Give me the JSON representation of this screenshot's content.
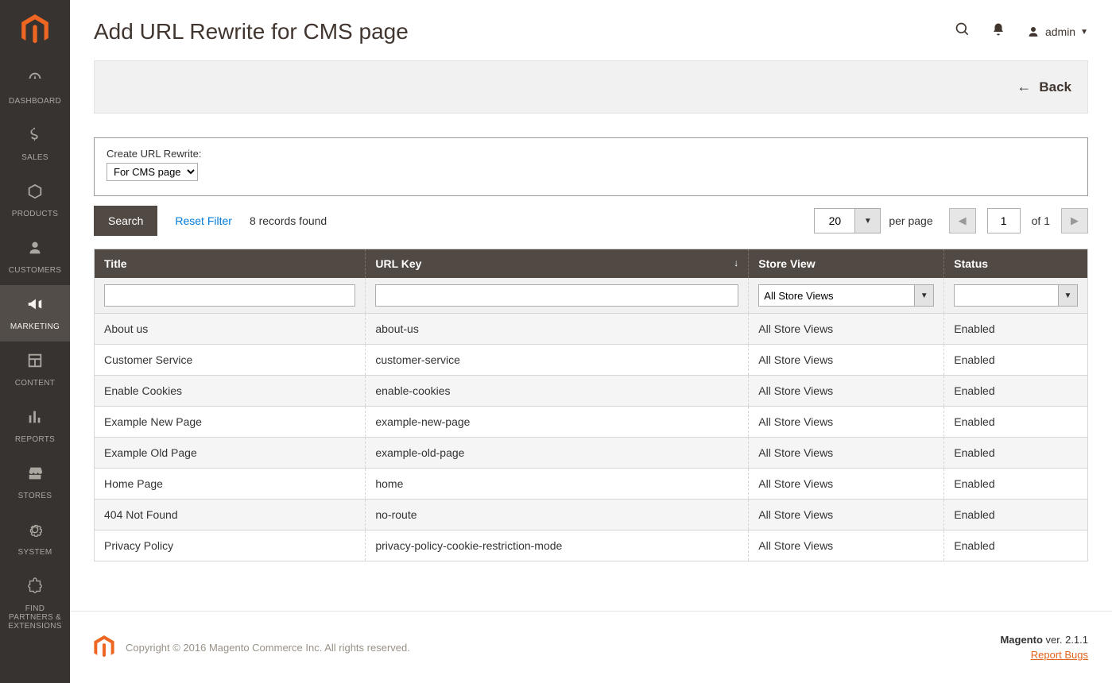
{
  "sidebar": {
    "items": [
      {
        "label": "DASHBOARD"
      },
      {
        "label": "SALES"
      },
      {
        "label": "PRODUCTS"
      },
      {
        "label": "CUSTOMERS"
      },
      {
        "label": "MARKETING"
      },
      {
        "label": "CONTENT"
      },
      {
        "label": "REPORTS"
      },
      {
        "label": "STORES"
      },
      {
        "label": "SYSTEM"
      },
      {
        "label": "FIND PARTNERS & EXTENSIONS"
      }
    ]
  },
  "header": {
    "title": "Add URL Rewrite for CMS page",
    "admin": "admin"
  },
  "toolbar": {
    "back": "Back"
  },
  "rewrite": {
    "label": "Create URL Rewrite:",
    "selected": "For CMS page"
  },
  "grid": {
    "search_label": "Search",
    "reset_label": "Reset Filter",
    "records_found": "8 records found",
    "per_page_value": "20",
    "per_page_label": "per page",
    "page_value": "1",
    "of_label": "of 1"
  },
  "columns": {
    "title": "Title",
    "url_key": "URL Key",
    "store_view": "Store View",
    "status": "Status"
  },
  "filters": {
    "store_view_selected": "All Store Views"
  },
  "rows": [
    {
      "title": "About us",
      "url_key": "about-us",
      "store": "All Store Views",
      "status": "Enabled"
    },
    {
      "title": "Customer Service",
      "url_key": "customer-service",
      "store": "All Store Views",
      "status": "Enabled"
    },
    {
      "title": "Enable Cookies",
      "url_key": "enable-cookies",
      "store": "All Store Views",
      "status": "Enabled"
    },
    {
      "title": "Example New Page",
      "url_key": "example-new-page",
      "store": "All Store Views",
      "status": "Enabled"
    },
    {
      "title": "Example Old Page",
      "url_key": "example-old-page",
      "store": "All Store Views",
      "status": "Enabled"
    },
    {
      "title": "Home Page",
      "url_key": "home",
      "store": "All Store Views",
      "status": "Enabled"
    },
    {
      "title": "404 Not Found",
      "url_key": "no-route",
      "store": "All Store Views",
      "status": "Enabled"
    },
    {
      "title": "Privacy Policy",
      "url_key": "privacy-policy-cookie-restriction-mode",
      "store": "All Store Views",
      "status": "Enabled"
    }
  ],
  "footer": {
    "copyright": "Copyright © 2016 Magento Commerce Inc. All rights reserved.",
    "product": "Magento",
    "version": " ver. 2.1.1",
    "report_bugs": "Report Bugs"
  }
}
